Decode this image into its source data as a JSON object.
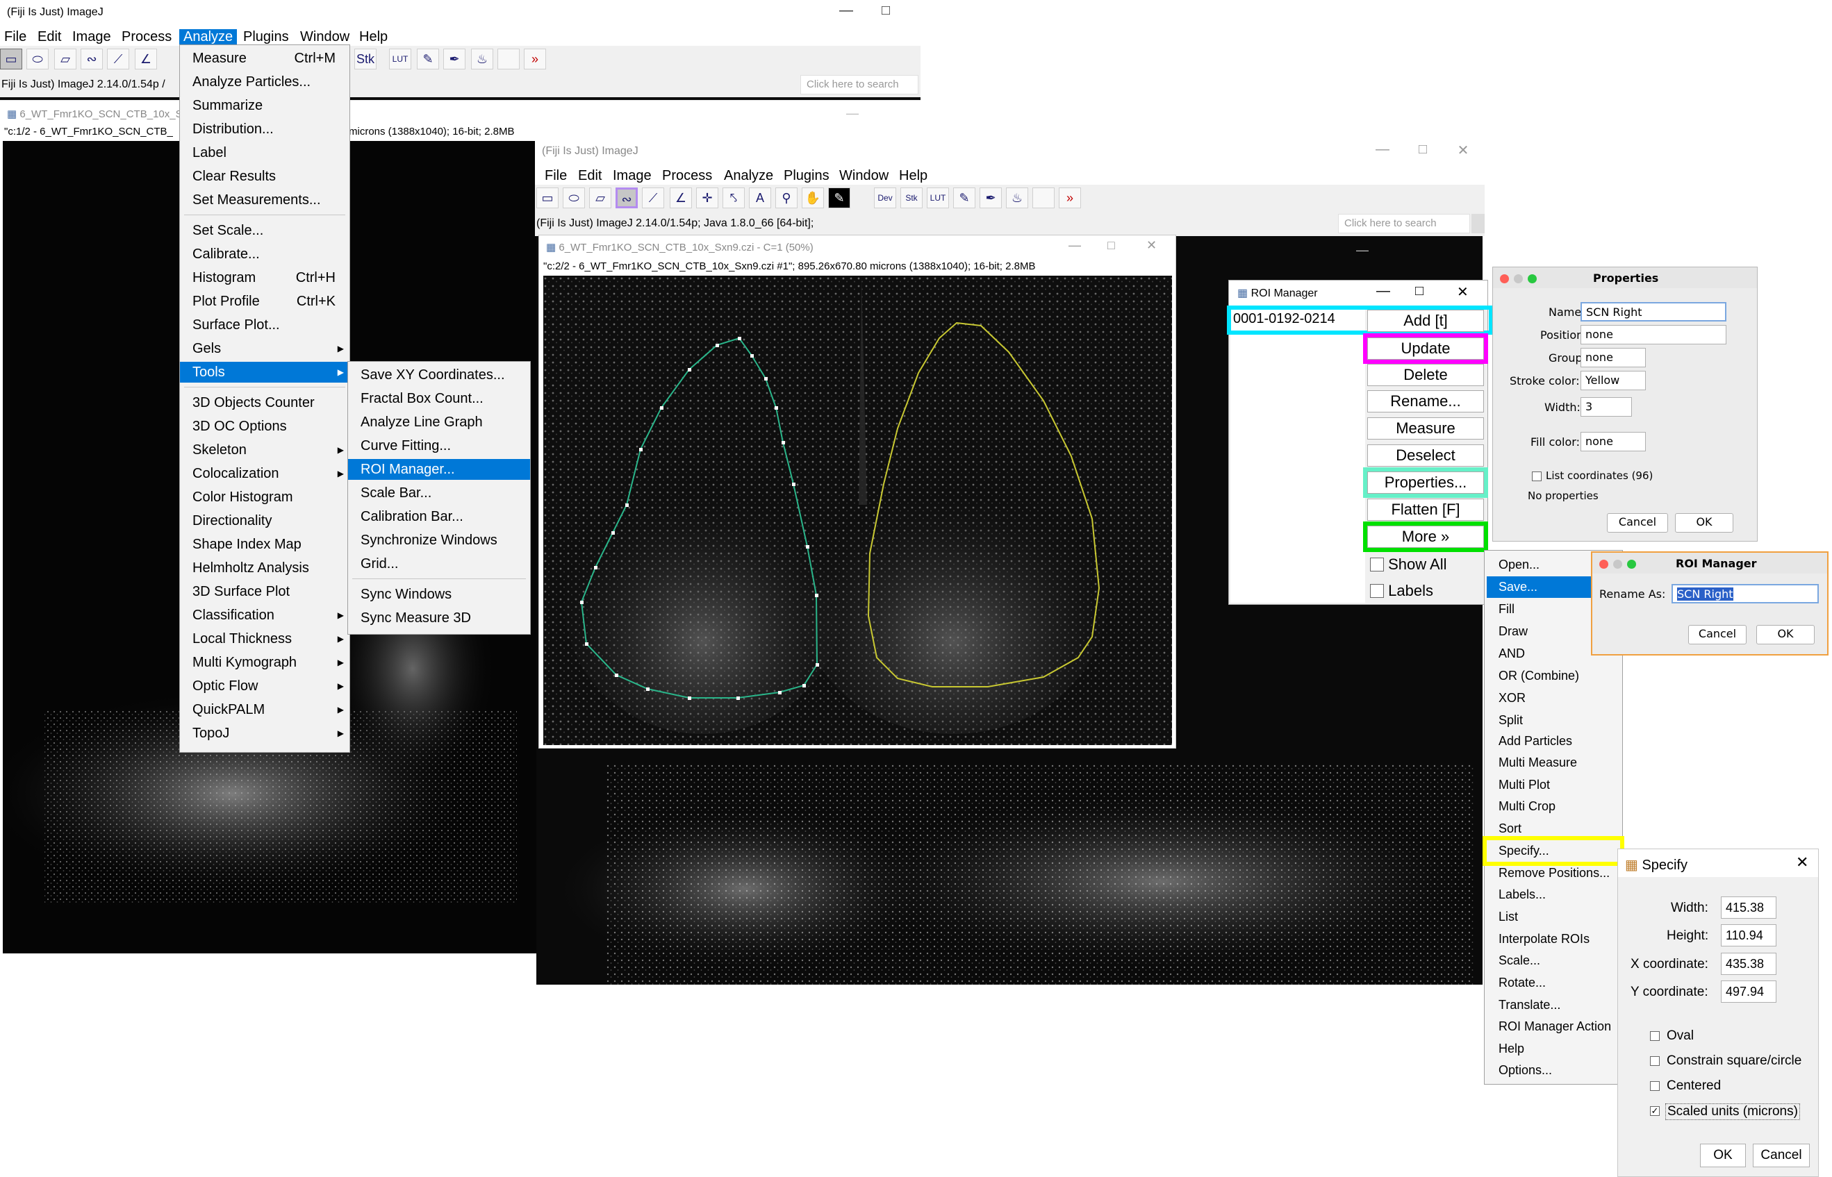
{
  "colors": {
    "accent": "#0078d7",
    "cyan": "#00e5ff",
    "magenta": "#ff00ff",
    "mint": "#66f0c8",
    "green": "#00e000",
    "yellow": "#ffff00",
    "lavender": "#b48cf0",
    "roi_yellow": "#c8c832",
    "roi_green": "#2ab58a"
  },
  "win1": {
    "title": "(Fiji Is Just) ImageJ",
    "menu": [
      "File",
      "Edit",
      "Image",
      "Process",
      "Analyze",
      "Plugins",
      "Window",
      "Help"
    ],
    "status": "Fiji Is Just) ImageJ 2.14.0/1.54p /",
    "search_placeholder": "Click here to search"
  },
  "image_window_back": {
    "title": "6_WT_Fmr1KO_SCN_CTB_10x_Sx",
    "info": "\"c:1/2 - 6_WT_Fmr1KO_SCN_CTB_",
    "info_tail": "microns (1388x1040); 16-bit; 2.8MB"
  },
  "analyze_menu": {
    "items": [
      {
        "label": "Measure",
        "shortcut": "Ctrl+M"
      },
      {
        "label": "Analyze Particles..."
      },
      {
        "label": "Summarize"
      },
      {
        "label": "Distribution..."
      },
      {
        "label": "Label"
      },
      {
        "label": "Clear Results"
      },
      {
        "label": "Set Measurements..."
      },
      {
        "label": "Set Scale..."
      },
      {
        "label": "Calibrate..."
      },
      {
        "label": "Histogram",
        "shortcut": "Ctrl+H"
      },
      {
        "label": "Plot Profile",
        "shortcut": "Ctrl+K"
      },
      {
        "label": "Surface Plot..."
      },
      {
        "label": "Gels"
      },
      {
        "label": "Tools"
      },
      {
        "label": "3D Objects Counter"
      },
      {
        "label": "3D OC Options"
      },
      {
        "label": "Skeleton"
      },
      {
        "label": "Colocalization"
      },
      {
        "label": "Color Histogram"
      },
      {
        "label": "Directionality"
      },
      {
        "label": "Shape Index Map"
      },
      {
        "label": "Helmholtz Analysis"
      },
      {
        "label": "3D Surface Plot"
      },
      {
        "label": "Classification"
      },
      {
        "label": "Local Thickness"
      },
      {
        "label": "Multi Kymograph"
      },
      {
        "label": "Optic Flow"
      },
      {
        "label": "QuickPALM"
      },
      {
        "label": "TopoJ"
      }
    ]
  },
  "tools_menu": {
    "items": [
      "Save XY Coordinates...",
      "Fractal Box Count...",
      "Analyze Line Graph",
      "Curve Fitting...",
      "ROI Manager...",
      "Scale Bar...",
      "Calibration Bar...",
      "Synchronize Windows",
      "Grid...",
      "Sync Windows",
      "Sync Measure 3D"
    ]
  },
  "win2": {
    "title": "(Fiji Is Just) ImageJ",
    "menu": [
      "File",
      "Edit",
      "Image",
      "Process",
      "Analyze",
      "Plugins",
      "Window",
      "Help"
    ],
    "status": "(Fiji Is Just) ImageJ 2.14.0/1.54p; Java 1.8.0_66 [64-bit];",
    "search_placeholder": "Click here to search"
  },
  "image_window_front": {
    "title": "6_WT_Fmr1KO_SCN_CTB_10x_Sxn9.czi - C=1 (50%)",
    "info": "\"c:2/2 - 6_WT_Fmr1KO_SCN_CTB_10x_Sxn9.czi #1\"; 895.26x670.80 microns (1388x1040); 16-bit; 2.8MB"
  },
  "roi_manager": {
    "title": "ROI Manager",
    "list_item": "0001-0192-0214",
    "buttons": [
      "Add [t]",
      "Update",
      "Delete",
      "Rename...",
      "Measure",
      "Deselect",
      "Properties...",
      "Flatten [F]",
      "More »"
    ],
    "checkboxes": [
      "Show All",
      "Labels"
    ]
  },
  "properties": {
    "title": "Properties",
    "name_label": "Name:",
    "name_value": "SCN Right",
    "position_label": "Position:",
    "position_value": "none",
    "group_label": "Group:",
    "group_value": "none",
    "stroke_label": "Stroke color:",
    "stroke_value": "Yellow",
    "width_label": "Width:",
    "width_value": "3",
    "fill_label": "Fill color:",
    "fill_value": "none",
    "list_coords": "List coordinates (96)",
    "no_props": "No properties",
    "cancel": "Cancel",
    "ok": "OK"
  },
  "more_menu": {
    "items": [
      "Open...",
      "Save...",
      "Fill",
      "Draw",
      "AND",
      "OR (Combine)",
      "XOR",
      "Split",
      "Add Particles",
      "Multi Measure",
      "Multi Plot",
      "Multi Crop",
      "Sort",
      "Specify...",
      "Remove Positions...",
      "Labels...",
      "List",
      "Interpolate ROIs",
      "Scale...",
      "Rotate...",
      "Translate...",
      "ROI Manager Action",
      "Help",
      "Options..."
    ]
  },
  "rename_dialog": {
    "title": "ROI Manager",
    "label": "Rename As:",
    "value": "SCN Right",
    "cancel": "Cancel",
    "ok": "OK"
  },
  "specify": {
    "title": "Specify",
    "width_label": "Width:",
    "width_value": "415.38",
    "height_label": "Height:",
    "height_value": "110.94",
    "x_label": "X coordinate:",
    "x_value": "435.38",
    "y_label": "Y coordinate:",
    "y_value": "497.94",
    "oval": "Oval",
    "constrain": "Constrain square/circle",
    "centered": "Centered",
    "scaled": "Scaled units (microns)",
    "ok": "OK",
    "cancel": "Cancel"
  }
}
